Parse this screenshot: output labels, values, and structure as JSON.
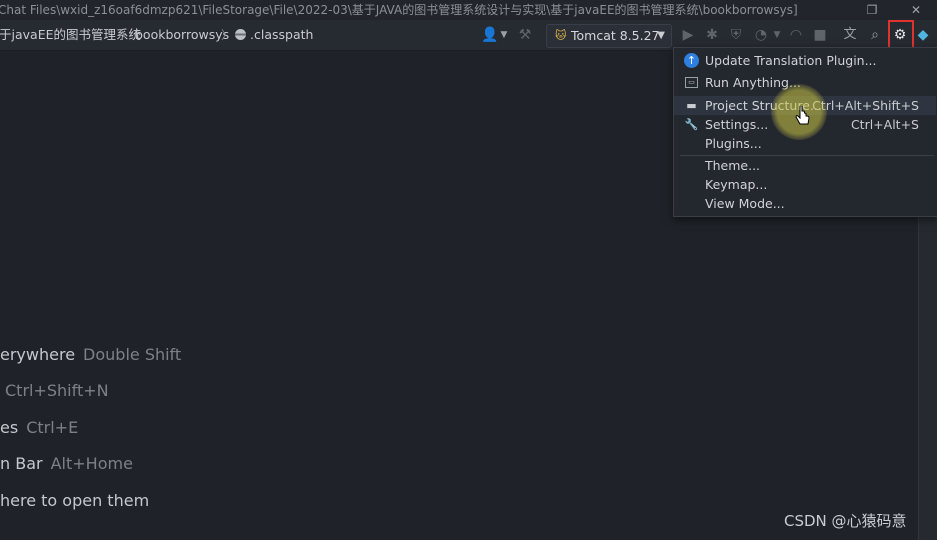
{
  "window": {
    "title": "Chat Files\\wxid_z16oaf6dmzp621\\FileStorage\\File\\2022-03\\基于JAVA的图书管理系统设计与实现\\基于javaEE的图书管理系统\\bookborrowsys]",
    "restore_glyph": "❐",
    "close_glyph": "✕"
  },
  "breadcrumb": {
    "items": [
      "于javaEE的图书管理系统",
      "bookborrowsys",
      ".classpath"
    ],
    "separator": "〉"
  },
  "toolbar": {
    "run_config": "Tomcat 8.5.27",
    "icons": [
      "user-icon",
      "hammer-icon",
      "run-icon",
      "debug-icon",
      "coverage-icon",
      "profile-icon",
      "stop-icon",
      "translate-icon",
      "search-icon",
      "gear-icon",
      "plugin-logo-icon"
    ]
  },
  "menu": {
    "items": [
      {
        "label": "Update Translation Plugin...",
        "shortcut": "",
        "icon": "update-icon"
      },
      {
        "label": "Run Anything...",
        "shortcut": "",
        "icon": "terminal-icon"
      },
      {
        "label": "Project Structure...",
        "shortcut": "Ctrl+Alt+Shift+S",
        "icon": "folder-icon"
      },
      {
        "label": "Settings...",
        "shortcut": "Ctrl+Alt+S",
        "icon": "wrench-icon"
      },
      {
        "label": "Plugins...",
        "shortcut": "",
        "icon": ""
      },
      {
        "label": "Theme...",
        "shortcut": "",
        "icon": ""
      },
      {
        "label": "Keymap...",
        "shortcut": "",
        "icon": ""
      },
      {
        "label": "View Mode...",
        "shortcut": "",
        "icon": ""
      }
    ]
  },
  "hints": [
    {
      "label": "erywhere",
      "shortcut": "Double Shift"
    },
    {
      "label": "",
      "shortcut": "Ctrl+Shift+N"
    },
    {
      "label": "es",
      "shortcut": "Ctrl+E"
    },
    {
      "label": "n Bar",
      "shortcut": "Alt+Home"
    },
    {
      "label": "here to open them",
      "shortcut": ""
    }
  ],
  "watermark": "CSDN @心猿码意",
  "colors": {
    "accent_red": "#e0332f",
    "tomcat": "#e8b94a",
    "update_blue": "#2f7fe0"
  }
}
